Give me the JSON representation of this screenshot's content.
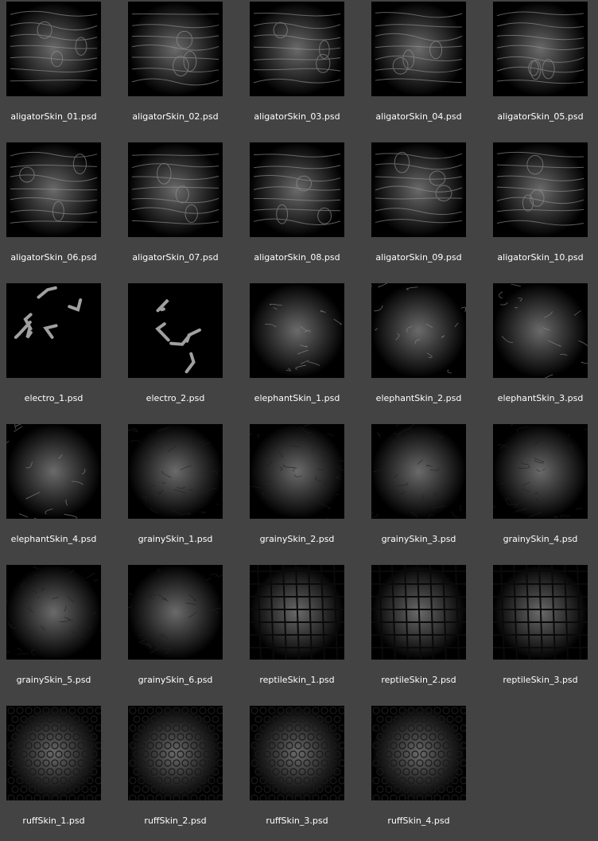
{
  "files": [
    {
      "name": "aligatorSkin_01.psd",
      "icon": "texture-thumbnail-icon"
    },
    {
      "name": "aligatorSkin_02.psd",
      "icon": "texture-thumbnail-icon"
    },
    {
      "name": "aligatorSkin_03.psd",
      "icon": "texture-thumbnail-icon"
    },
    {
      "name": "aligatorSkin_04.psd",
      "icon": "texture-thumbnail-icon"
    },
    {
      "name": "aligatorSkin_05.psd",
      "icon": "texture-thumbnail-icon"
    },
    {
      "name": "aligatorSkin_06.psd",
      "icon": "texture-thumbnail-icon"
    },
    {
      "name": "aligatorSkin_07.psd",
      "icon": "texture-thumbnail-icon"
    },
    {
      "name": "aligatorSkin_08.psd",
      "icon": "texture-thumbnail-icon"
    },
    {
      "name": "aligatorSkin_09.psd",
      "icon": "texture-thumbnail-icon"
    },
    {
      "name": "aligatorSkin_10.psd",
      "icon": "texture-thumbnail-icon"
    },
    {
      "name": "electro_1.psd",
      "icon": "texture-thumbnail-icon"
    },
    {
      "name": "electro_2.psd",
      "icon": "texture-thumbnail-icon"
    },
    {
      "name": "elephantSkin_1.psd",
      "icon": "texture-thumbnail-icon"
    },
    {
      "name": "elephantSkin_2.psd",
      "icon": "texture-thumbnail-icon"
    },
    {
      "name": "elephantSkin_3.psd",
      "icon": "texture-thumbnail-icon"
    },
    {
      "name": "elephantSkin_4.psd",
      "icon": "texture-thumbnail-icon"
    },
    {
      "name": "grainySkin_1.psd",
      "icon": "texture-thumbnail-icon"
    },
    {
      "name": "grainySkin_2.psd",
      "icon": "texture-thumbnail-icon"
    },
    {
      "name": "grainySkin_3.psd",
      "icon": "texture-thumbnail-icon"
    },
    {
      "name": "grainySkin_4.psd",
      "icon": "texture-thumbnail-icon"
    },
    {
      "name": "grainySkin_5.psd",
      "icon": "texture-thumbnail-icon"
    },
    {
      "name": "grainySkin_6.psd",
      "icon": "texture-thumbnail-icon"
    },
    {
      "name": "reptileSkin_1.psd",
      "icon": "texture-thumbnail-icon"
    },
    {
      "name": "reptileSkin_2.psd",
      "icon": "texture-thumbnail-icon"
    },
    {
      "name": "reptileSkin_3.psd",
      "icon": "texture-thumbnail-icon"
    },
    {
      "name": "ruffSkin_1.psd",
      "icon": "texture-thumbnail-icon"
    },
    {
      "name": "ruffSkin_2.psd",
      "icon": "texture-thumbnail-icon"
    },
    {
      "name": "ruffSkin_3.psd",
      "icon": "texture-thumbnail-icon"
    },
    {
      "name": "ruffSkin_4.psd",
      "icon": "texture-thumbnail-icon"
    }
  ],
  "colors": {
    "background": "#434343",
    "thumbnail": "#000000",
    "label": "#ffffff"
  }
}
